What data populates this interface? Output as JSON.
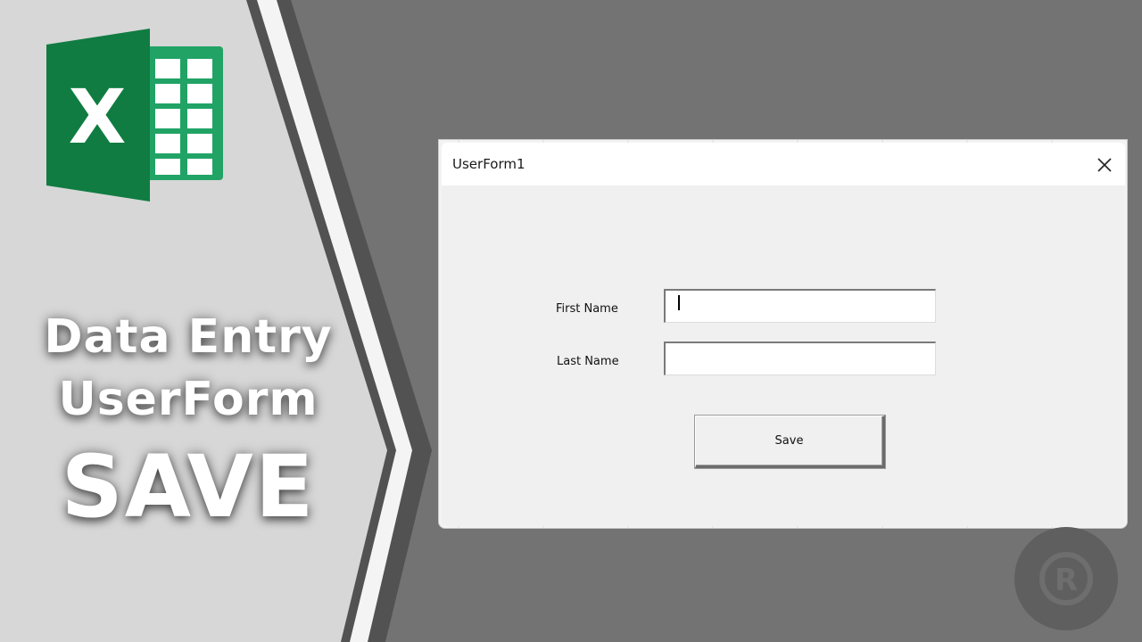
{
  "thumbnail": {
    "headline_line1": "Data Entry",
    "headline_line2": "UserForm",
    "headline_line3": "SAVE",
    "logo_icon": "excel-logo-icon",
    "logo_letter": "X",
    "watermark_icon": "registered-r-icon",
    "watermark_letter": "R"
  },
  "userform": {
    "title": "UserForm1",
    "close_icon": "close-icon",
    "fields": [
      {
        "label": "First Name",
        "value": "",
        "focused": true
      },
      {
        "label": "Last Name",
        "value": "",
        "focused": false
      }
    ],
    "save_label": "Save"
  },
  "colors": {
    "background": "#737373",
    "left_panel": "#d6d6d6",
    "chevron_dark": "#4f4f4f",
    "excel_green_dark": "#107c41",
    "excel_green_light": "#21a366",
    "dialog_body": "#f0f0f0",
    "title_bar": "#ffffff"
  }
}
